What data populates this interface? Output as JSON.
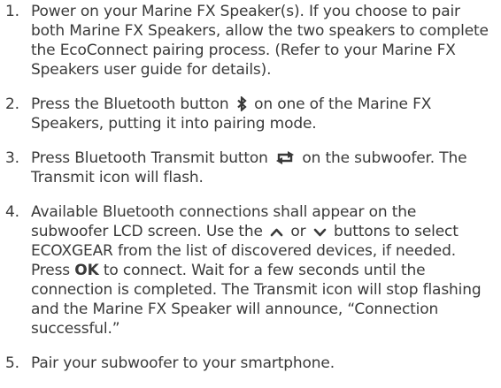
{
  "steps": [
    {
      "number": "1.",
      "text": "Power on your Marine FX Speaker(s). If you choose to pair both Marine FX Speakers, allow the two speakers to complete the EcoConnect pairing process. (Refer to your Marine FX Speakers user guide for details)."
    },
    {
      "number": "2.",
      "before": "Press the Bluetooth button",
      "icon": "bluetooth-icon",
      "after": "on one of the Marine FX Speakers, putting it into pairing mode."
    },
    {
      "number": "3.",
      "before": "Press Bluetooth Transmit button",
      "icon": "transmit-arrows-icon",
      "after": "on the subwoofer. The Transmit icon will flash."
    },
    {
      "number": "4.",
      "before": "Available Bluetooth connections shall appear on the subwoofer LCD screen. Use the",
      "icon_up": "chevron-up-icon",
      "or_text": "or",
      "icon_down": "chevron-down-icon",
      "middle": "buttons to select ECOXGEAR from the list of discovered devices, if needed. Press",
      "bold": "OK",
      "after": "to connect. Wait for a few seconds until the connection is completed. The Transmit icon will stop flashing and the Marine FX Speaker will announce, “Connection successful.”"
    },
    {
      "number": "5.",
      "text": "Pair your subwoofer to your smartphone."
    }
  ],
  "colors": {
    "text": "#3a3a3a",
    "background": "#ffffff"
  }
}
